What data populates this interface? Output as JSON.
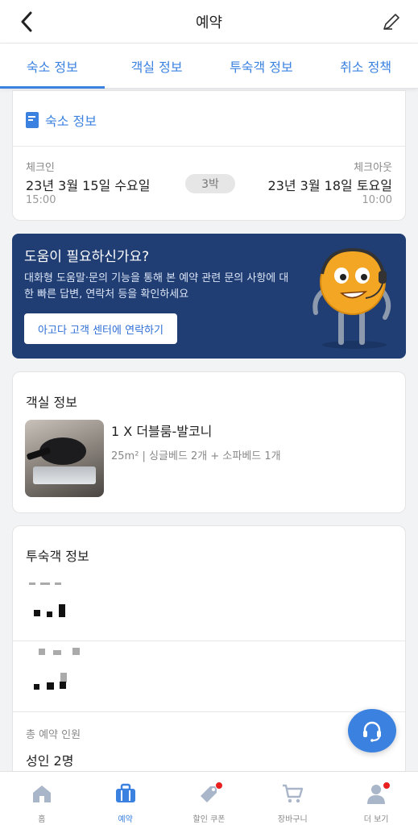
{
  "header": {
    "title": "예약",
    "back_icon": "chevron-left-icon",
    "edit_icon": "pencil-icon"
  },
  "tabs": [
    {
      "label": "숙소 정보",
      "active": true
    },
    {
      "label": "객실 정보",
      "active": false
    },
    {
      "label": "투숙객 정보",
      "active": false
    },
    {
      "label": "취소 정책",
      "active": false
    }
  ],
  "stay": {
    "pdf_label": "숙소 정보",
    "checkin_label": "체크인",
    "checkin_date": "23년 3월 15일 수요일",
    "checkin_time": "15:00",
    "nights": "3박",
    "checkout_label": "체크아웃",
    "checkout_date": "23년 3월 18일 토요일",
    "checkout_time": "10:00"
  },
  "help": {
    "title": "도움이 필요하신가요?",
    "description": "대화형 도움말·문의 기능을 통해 본 예약 관련 문의 사항에 대한 빠른 답변, 연락처 등을 확인하세요",
    "button_label": "아고다 고객 센터에 연락하기",
    "banner_color": "#203e74"
  },
  "room": {
    "heading": "객실 정보",
    "name": "1 X 더블룸-발코니",
    "spec": "25m² | 싱글베드 2개 + 소파베드 1개"
  },
  "guest": {
    "heading": "투숙객 정보",
    "total_label": "총 예약 인원",
    "total_value": "성인 2명"
  },
  "fab_icon": "headset-icon",
  "nav": [
    {
      "label": "홈",
      "icon": "home-icon",
      "active": false,
      "badge": false
    },
    {
      "label": "예약",
      "icon": "briefcase-icon",
      "active": true,
      "badge": false
    },
    {
      "label": "할인 쿠폰",
      "icon": "coupon-tag-icon",
      "active": false,
      "badge": true
    },
    {
      "label": "장바구니",
      "icon": "cart-icon",
      "active": false,
      "badge": false
    },
    {
      "label": "더 보기",
      "icon": "person-icon",
      "active": false,
      "badge": true
    }
  ],
  "colors": {
    "accent": "#3b82e0",
    "badge": "#e8201f"
  }
}
